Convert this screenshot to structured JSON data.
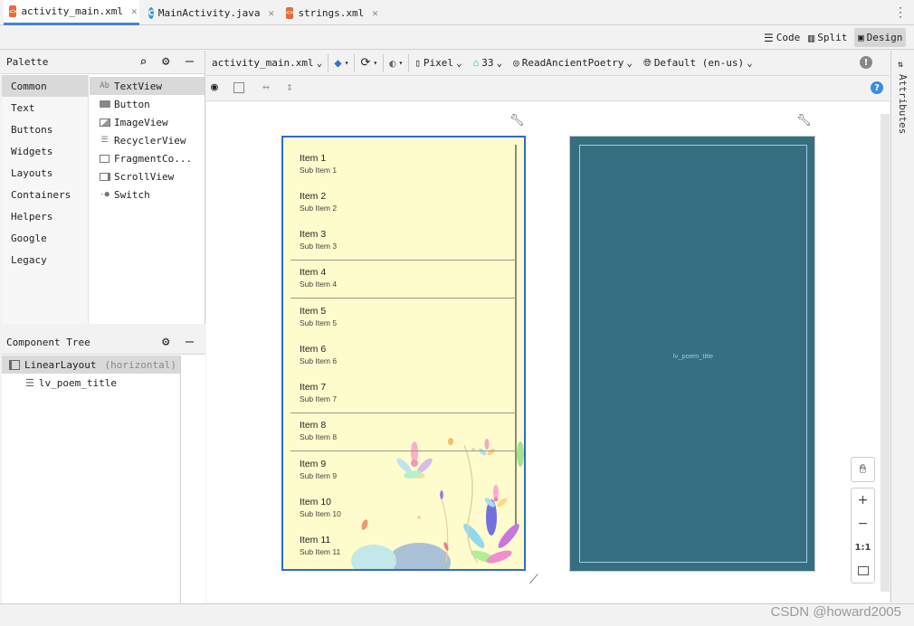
{
  "tabs": [
    {
      "label": "activity_main.xml",
      "icon": "xml-file-icon",
      "active": true
    },
    {
      "label": "MainActivity.java",
      "icon": "java-class-icon",
      "active": false
    },
    {
      "label": "strings.xml",
      "icon": "xml-file-icon",
      "active": false
    }
  ],
  "view_modes": {
    "code": "Code",
    "split": "Split",
    "design": "Design"
  },
  "palette": {
    "title": "Palette",
    "categories": [
      "Common",
      "Text",
      "Buttons",
      "Widgets",
      "Layouts",
      "Containers",
      "Helpers",
      "Google",
      "Legacy"
    ],
    "widgets": [
      "TextView",
      "Button",
      "ImageView",
      "RecyclerView",
      "FragmentCo...",
      "ScrollView",
      "Switch"
    ],
    "textview_icon_text": "Ab"
  },
  "component_tree": {
    "title": "Component Tree",
    "root": "LinearLayout",
    "root_hint": "(horizontal)",
    "child": "lv_poem_title"
  },
  "toolbar": {
    "file": "activity_main.xml",
    "device": "Pixel",
    "api": "33",
    "theme": "ReadAncientPoetry",
    "locale": "Default (en-us)"
  },
  "preview_list": [
    {
      "title": "Item 1",
      "sub": "Sub Item 1"
    },
    {
      "title": "Item 2",
      "sub": "Sub Item 2"
    },
    {
      "title": "Item 3",
      "sub": "Sub Item 3"
    },
    {
      "title": "Item 4",
      "sub": "Sub Item 4"
    },
    {
      "title": "Item 5",
      "sub": "Sub Item 5"
    },
    {
      "title": "Item 6",
      "sub": "Sub Item 6"
    },
    {
      "title": "Item 7",
      "sub": "Sub Item 7"
    },
    {
      "title": "Item 8",
      "sub": "Sub Item 8"
    },
    {
      "title": "Item 9",
      "sub": "Sub Item 9"
    },
    {
      "title": "Item 10",
      "sub": "Sub Item 10"
    },
    {
      "title": "Item 11",
      "sub": "Sub Item 11"
    }
  ],
  "blueprint_label": "lv_poem_title",
  "zoom": {
    "plus": "+",
    "minus": "−",
    "one_to_one": "1:1"
  },
  "attributes_label": "Attributes",
  "watermark": "CSDN @howard2005",
  "colors": {
    "accent": "#2f6bcf",
    "blueprint_bg": "#356f81",
    "preview_bg": "#fefccc"
  }
}
